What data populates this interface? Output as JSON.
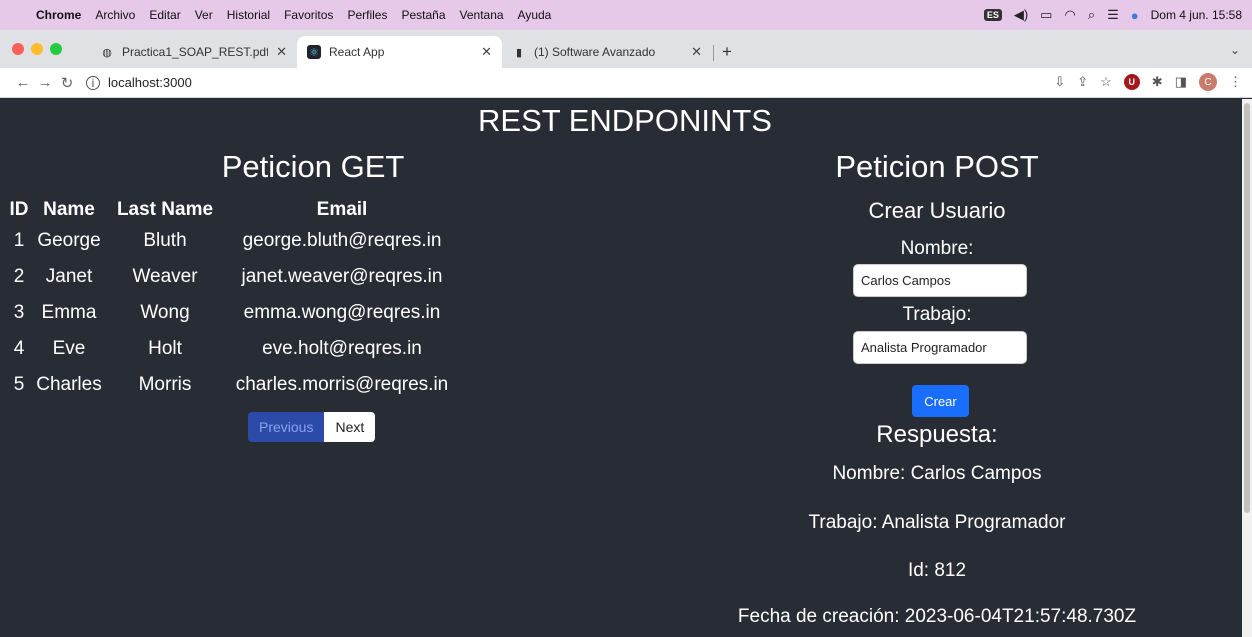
{
  "menubar": {
    "items": [
      "Chrome",
      "Archivo",
      "Editar",
      "Ver",
      "Historial",
      "Favoritos",
      "Perfiles",
      "Pestaña",
      "Ventana",
      "Ayuda"
    ],
    "input_source": "ES",
    "datetime": "Dom 4 jun.  15:58"
  },
  "tabs": [
    {
      "title": "Practica1_SOAP_REST.pdf",
      "icon": "globe-icon"
    },
    {
      "title": "React App",
      "icon": "react-icon"
    },
    {
      "title": "(1) Software Avanzado",
      "icon": "phone-icon"
    }
  ],
  "toolbar": {
    "url": "localhost:3000",
    "profile_initial": "C",
    "extension_initial": "U"
  },
  "page": {
    "title": "REST ENDPONINTS",
    "get": {
      "title": "Peticion GET",
      "headers": [
        "ID",
        "Name",
        "Last Name",
        "Email"
      ],
      "rows": [
        [
          "1",
          "George",
          "Bluth",
          "george.bluth@reqres.in"
        ],
        [
          "2",
          "Janet",
          "Weaver",
          "janet.weaver@reqres.in"
        ],
        [
          "3",
          "Emma",
          "Wong",
          "emma.wong@reqres.in"
        ],
        [
          "4",
          "Eve",
          "Holt",
          "eve.holt@reqres.in"
        ],
        [
          "5",
          "Charles",
          "Morris",
          "charles.morris@reqres.in"
        ]
      ],
      "previous_label": "Previous",
      "next_label": "Next"
    },
    "post": {
      "title": "Peticion POST",
      "subtitle": "Crear Usuario",
      "nombre_label": "Nombre:",
      "nombre_value": "Carlos Campos",
      "trabajo_label": "Trabajo:",
      "trabajo_value": "Analista Programador",
      "submit_label": "Crear",
      "response_title": "Respuesta:",
      "response_nombre": "Nombre: Carlos Campos",
      "response_trabajo": "Trabajo: Analista Programador",
      "response_id": "Id: 812",
      "response_fecha": "Fecha de creación: 2023-06-04T21:57:48.730Z"
    }
  },
  "colors": {
    "page_bg": "#282c34",
    "menubar_bg": "#e6c8e8",
    "primary_button": "#1a6efd",
    "disabled_pager": "#2c4ba8"
  }
}
